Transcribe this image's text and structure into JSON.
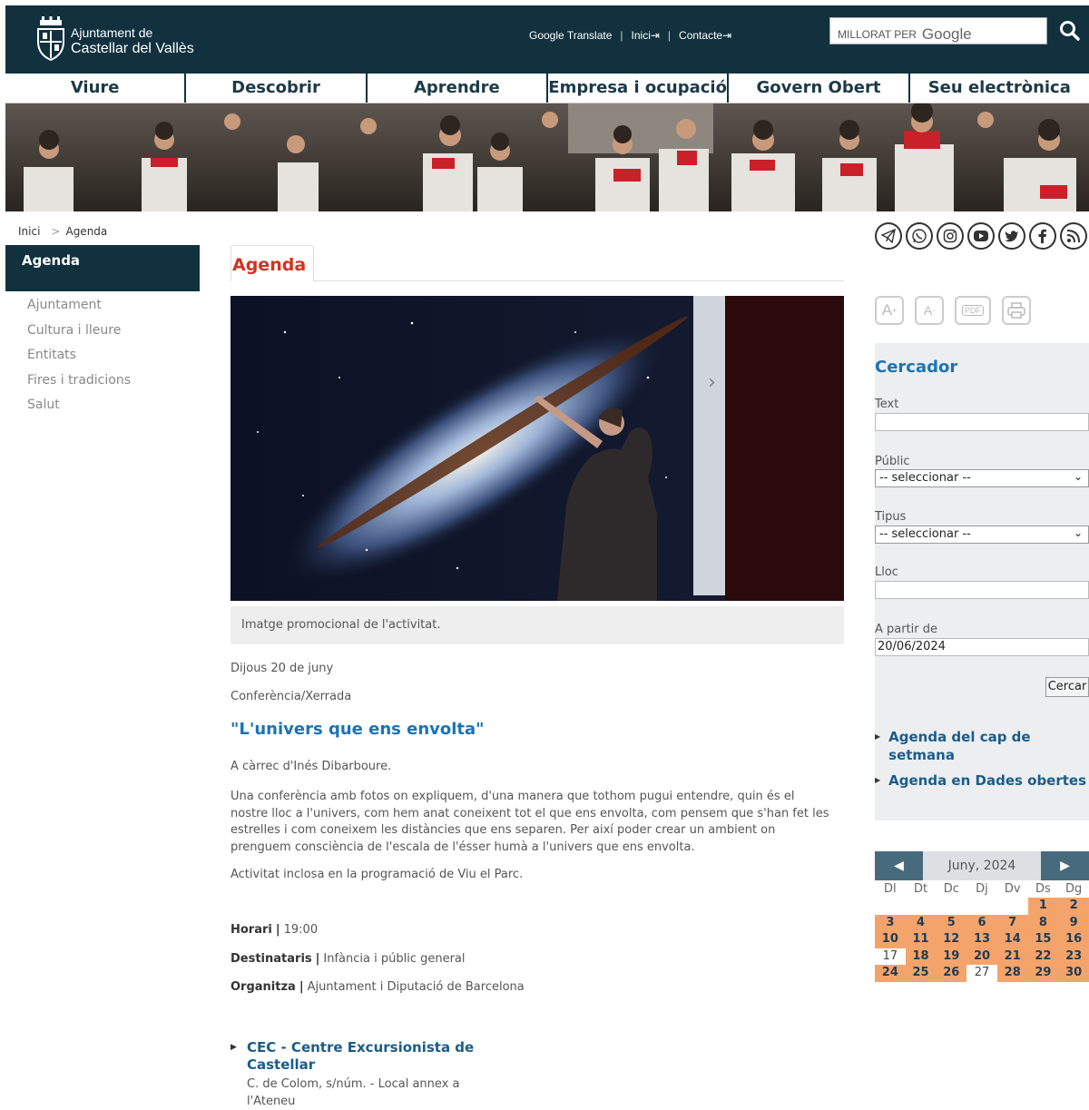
{
  "header": {
    "logo_line1": "Ajuntament de",
    "logo_line2": "Castellar del Vallès",
    "links": [
      "Google Translate",
      "Inici",
      "Contacte"
    ],
    "search_prefix": "MILLORAT PER",
    "search_brand": "Google"
  },
  "nav": [
    "Viure",
    "Descobrir",
    "Aprendre",
    "Empresa i ocupació",
    "Govern Obert",
    "Seu electrònica"
  ],
  "breadcrumb": {
    "home": "Inici",
    "current": "Agenda"
  },
  "sidebar": {
    "title": "Agenda",
    "items": [
      "Ajuntament",
      "Cultura i lleure",
      "Entitats",
      "Fires i tradicions",
      "Salut"
    ]
  },
  "main": {
    "tab": "Agenda",
    "caption": "Imatge promocional de l'activitat.",
    "date": "Dijous 20 de juny",
    "type": "Conferència/Xerrada",
    "title": "\"L'univers que ens envolta\"",
    "by": "A càrrec d'Inés Dibarboure.",
    "description": "Una conferència amb fotos on expliquem, d'una manera que tothom pugui entendre, quin és el nostre lloc a l'univers, com hem anat coneixent tot el que ens envolta, com pensem que s'han fet les estrelles i com coneixem les distàncies que ens separen. Per així poder crear un ambient on prenguem consciència de l'escala de l'ésser humà a l'univers que ens envolta.",
    "included": "Activitat inclosa en la programació de Viu el Parc.",
    "facts": [
      {
        "label": "Horari",
        "value": "19:00"
      },
      {
        "label": "Destinataris",
        "value": "Infància i públic general"
      },
      {
        "label": "Organitza",
        "value": "Ajuntament i Diputació de Barcelona"
      }
    ],
    "location": {
      "name": "CEC - Centre Excursionista de Castellar",
      "address": "C. de Colom, s/núm. - Local annex a l'Ateneu"
    }
  },
  "social_icons": [
    "telegram-icon",
    "whatsapp-icon",
    "instagram-icon",
    "youtube-icon",
    "twitter-icon",
    "facebook-icon",
    "rss-icon"
  ],
  "tools": {
    "font_up": "A",
    "font_down": "A",
    "pdf": "PDF"
  },
  "finder": {
    "title": "Cercador",
    "text_label": "Text",
    "public_label": "Públic",
    "public_value": "-- seleccionar --",
    "type_label": "Tipus",
    "type_value": "-- seleccionar --",
    "place_label": "Lloc",
    "from_label": "A partir de",
    "from_value": "20/06/2024",
    "button": "Cercar",
    "links": [
      "Agenda del cap de setmana",
      "Agenda en Dades obertes"
    ]
  },
  "calendar": {
    "month": "Juny, 2024",
    "weekdays": [
      "Dl",
      "Dt",
      "Dc",
      "Dj",
      "Dv",
      "Ds",
      "Dg"
    ],
    "leading_blanks": 5,
    "days": 30,
    "days_without_events": [
      17,
      27
    ]
  },
  "colors": {
    "header_bg": "#11313f",
    "accent_red": "#d23321",
    "link_blue": "#1a73b8",
    "calendar_event": "#f4a46b"
  }
}
